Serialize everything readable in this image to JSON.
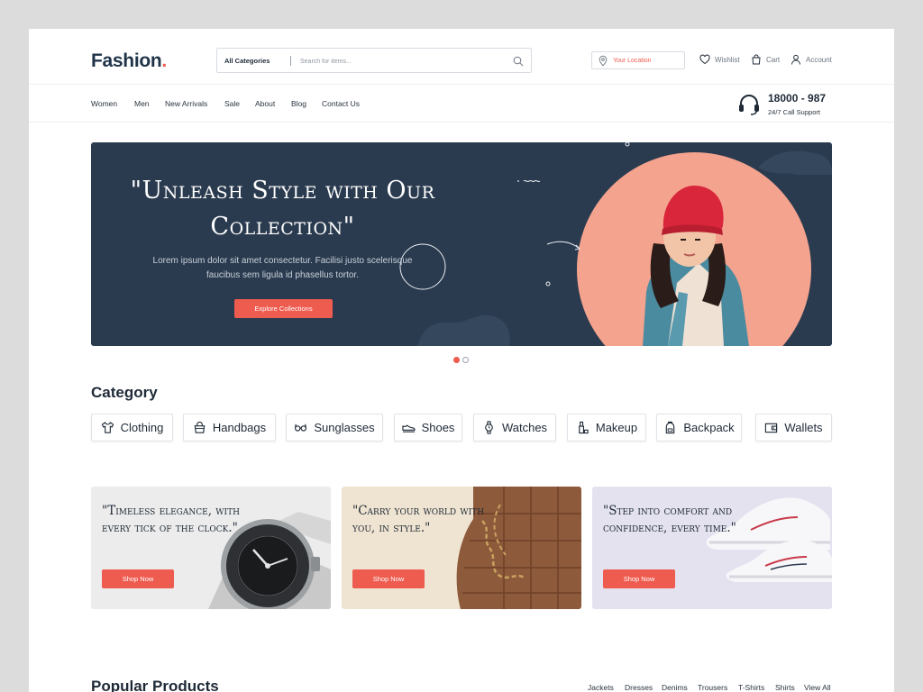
{
  "logo": {
    "text": "Fashion",
    "dot": "."
  },
  "search": {
    "category": "All Categories",
    "placeholder": "Search for items..."
  },
  "location": {
    "label": "Your Location"
  },
  "header_links": {
    "wishlist": "Wishlist",
    "cart": "Cart",
    "account": "Account"
  },
  "nav": {
    "items": [
      "Women",
      "Men",
      "New Arrivals",
      "Sale",
      "About",
      "Blog",
      "Contact Us"
    ]
  },
  "support": {
    "number": "18000 - 987",
    "label": "24/7 Call Support"
  },
  "hero": {
    "title": "\"Unleash Style with Our Collection\"",
    "text": "Lorem ipsum dolor sit amet consectetur. Facilisi justo scelerisque faucibus sem ligula id phasellus tortor.",
    "cta": "Explore Collections",
    "slides": 2,
    "active_slide": 1
  },
  "category": {
    "title": "Category",
    "items": [
      {
        "label": "Clothing",
        "icon": "tshirt-icon"
      },
      {
        "label": "Handbags",
        "icon": "handbag-icon"
      },
      {
        "label": "Sunglasses",
        "icon": "sunglasses-icon"
      },
      {
        "label": "Shoes",
        "icon": "shoe-icon"
      },
      {
        "label": "Watches",
        "icon": "watch-icon"
      },
      {
        "label": "Makeup",
        "icon": "makeup-icon"
      },
      {
        "label": "Backpack",
        "icon": "backpack-icon"
      },
      {
        "label": "Wallets",
        "icon": "wallet-icon"
      }
    ]
  },
  "promos": [
    {
      "quote": "\"Timeless elegance, with every tick of the clock.\"",
      "cta": "Shop Now",
      "image": "wristwatch"
    },
    {
      "quote": "\"Carry your world with you, in style.\"",
      "cta": "Shop Now",
      "image": "leather-handbag"
    },
    {
      "quote": "\"Step into comfort and confidence, every time.\"",
      "cta": "Shop Now",
      "image": "white-sneakers"
    }
  ],
  "popular": {
    "title": "Popular Products",
    "tabs": [
      "Jackets",
      "Dresses",
      "Denims",
      "Trousers",
      "T-Shirts",
      "Shirts",
      "View All"
    ]
  },
  "colors": {
    "accent": "#ee5b4f",
    "hero_bg": "#2b3b4f",
    "text": "#1f2a37"
  }
}
